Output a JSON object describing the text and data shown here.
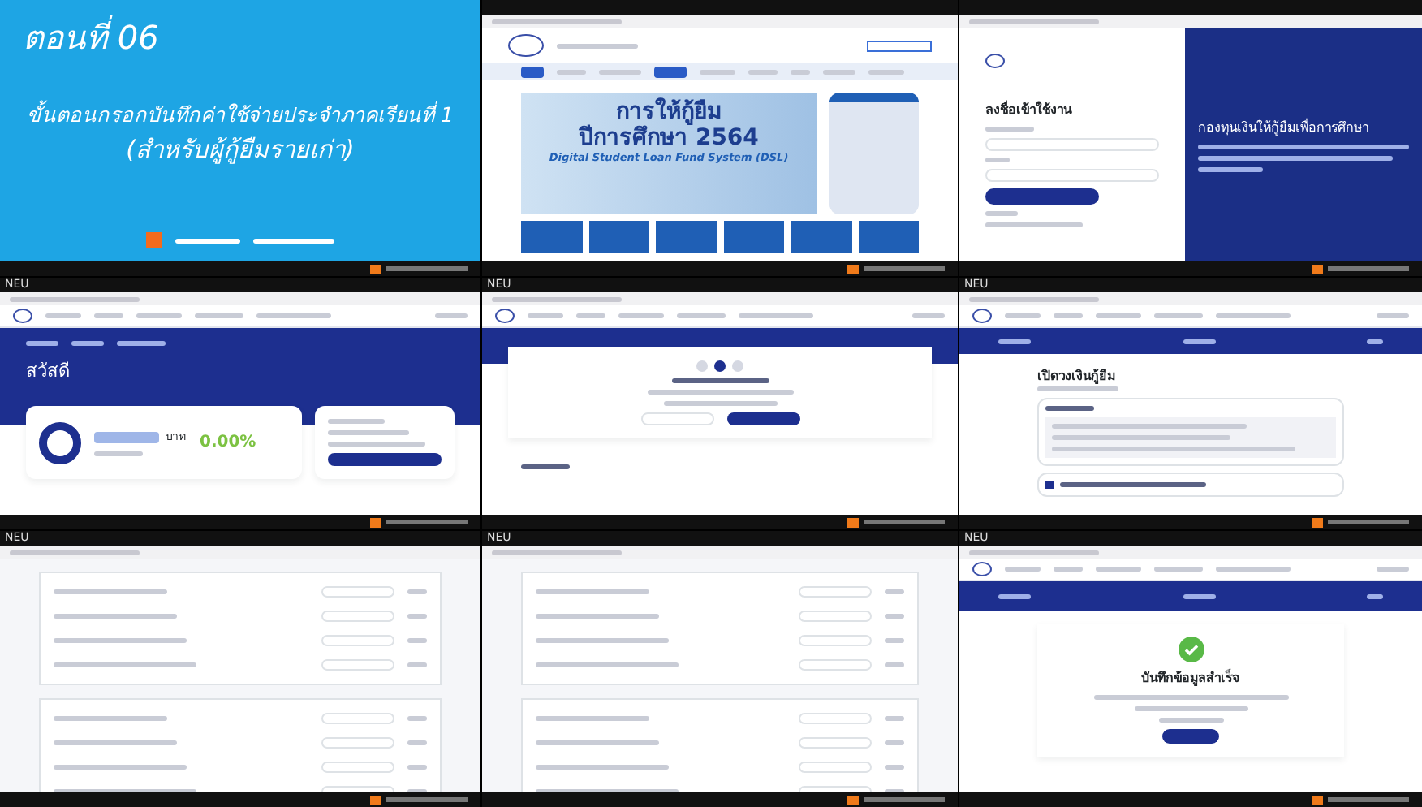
{
  "tiles": [
    {
      "kind": "title",
      "episode": "ตอนที่ 06",
      "heading": "ขั้นตอนกรอกบันทึกค่าใช้จ่ายประจำภาคเรียนที่ 1",
      "subheading": "(สำหรับผู้กู้ยืมรายเก่า)"
    },
    {
      "kind": "home",
      "banner_title": "การให้กู้ยืม",
      "banner_year": "ปีการศึกษา 2564",
      "banner_caption": "Digital Student Loan Fund System (DSL)"
    },
    {
      "kind": "login",
      "heading": "ลงชื่อเข้าใช้งาน",
      "panel_title": "กองทุนเงินให้กู้ยืมเพื่อการศึกษา"
    },
    {
      "kind": "dashboard",
      "label": "NEU",
      "greeting": "สวัสดี",
      "amount_unit": "บาท",
      "percent": "0.00%"
    },
    {
      "kind": "status",
      "label": "NEU"
    },
    {
      "kind": "form",
      "label": "NEU",
      "heading": "เปิดวงเงินกู้ยืม"
    },
    {
      "kind": "list",
      "label": "NEU"
    },
    {
      "kind": "list",
      "label": "NEU"
    },
    {
      "kind": "success",
      "label": "NEU",
      "heading": "บันทึกข้อมูลสำเร็จ"
    }
  ]
}
